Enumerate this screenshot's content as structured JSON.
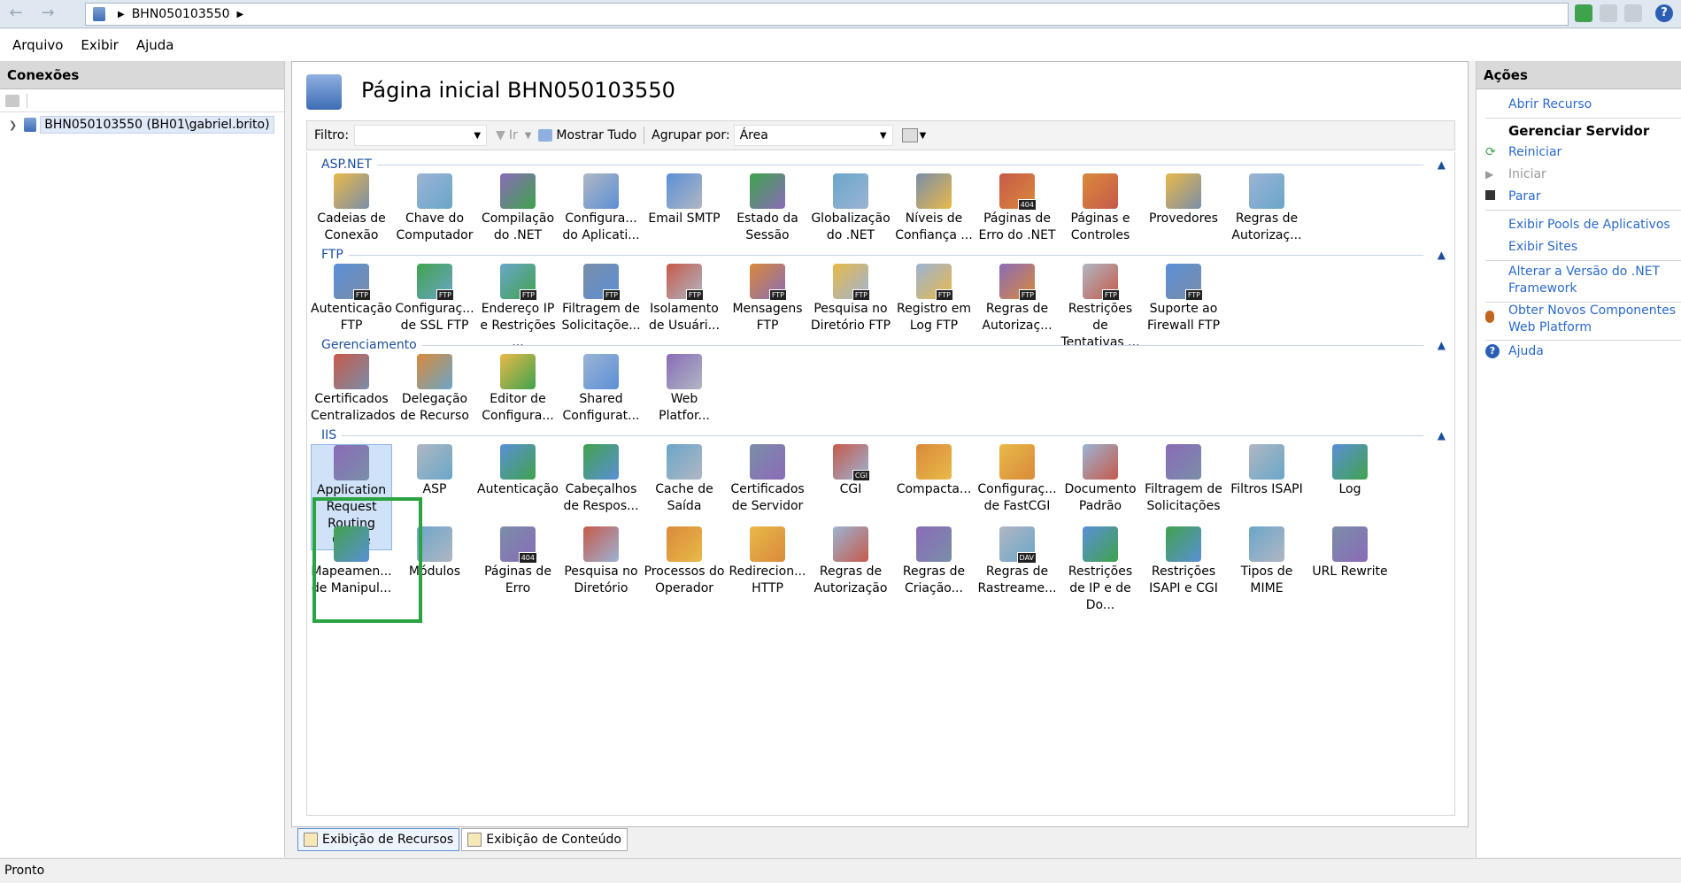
{
  "address": {
    "crumb": "BHN050103550"
  },
  "menu": [
    "Arquivo",
    "Exibir",
    "Ajuda"
  ],
  "connections": {
    "title": "Conexões",
    "node": "BHN050103550 (BH01\\gabriel.brito)"
  },
  "page": {
    "title": "Página inicial BHN050103550"
  },
  "filter": {
    "label": "Filtro:",
    "go": "Ir",
    "show_all": "Mostrar Tudo",
    "group_label": "Agrupar por:",
    "group_value": "Área"
  },
  "sections": {
    "aspnet": {
      "title": "ASP.NET",
      "items": [
        "Cadeias de Conexão",
        "Chave do Computador",
        "Compilação do .NET",
        "Configura... do Aplicati...",
        "Email SMTP",
        "Estado da Sessão",
        "Globalização do .NET",
        "Níveis de Confiança ...",
        "Páginas de Erro do .NET",
        "Páginas e Controles",
        "Provedores",
        "Regras de Autorizaç..."
      ]
    },
    "ftp": {
      "title": "FTP",
      "items": [
        "Autenticação FTP",
        "Configuraç... de SSL FTP",
        "Endereço IP e Restrições ...",
        "Filtragem de Solicitaçõe...",
        "Isolamento de Usuári...",
        "Mensagens FTP",
        "Pesquisa no Diretório FTP",
        "Registro em Log FTP",
        "Regras de Autorizaç...",
        "Restrições de Tentativas ...",
        "Suporte ao Firewall FTP"
      ]
    },
    "mgmt": {
      "title": "Gerenciamento",
      "items": [
        "Certificados Centralizados",
        "Delegação de Recurso",
        "Editor de Configura...",
        "Shared Configurat...",
        "Web Platfor..."
      ]
    },
    "iis": {
      "title": "IIS",
      "items": [
        "Application Request Routing Cache",
        "ASP",
        "Autenticação",
        "Cabeçalhos de Respos...",
        "Cache de Saída",
        "Certificados de Servidor",
        "CGI",
        "Compacta...",
        "Configuraç... de FastCGI",
        "Documento Padrão",
        "Filtragem de Solicitações",
        "Filtros ISAPI",
        "Log",
        "Mapeamen... de Manipul...",
        "Módulos",
        "Páginas de Erro",
        "Pesquisa no Diretório",
        "Processos do Operador",
        "Redirecion... HTTP",
        "Regras de Autorização",
        "Regras de Criação...",
        "Regras de Rastreame...",
        "Restrições de IP e de Do...",
        "Restrições ISAPI e CGI",
        "Tipos de MIME",
        "URL Rewrite"
      ]
    }
  },
  "badges": {
    "ftp": "FTP",
    "err": "404",
    "cgi": "CGI",
    "dav": "DAV"
  },
  "tabs": {
    "features": "Exibição de Recursos",
    "content": "Exibição de Conteúdo"
  },
  "actions": {
    "title": "Ações",
    "open": "Abrir Recurso",
    "manage": "Gerenciar Servidor",
    "restart": "Reiniciar",
    "start": "Iniciar",
    "stop": "Parar",
    "pools": "Exibir Pools de Aplicativos",
    "sites": "Exibir Sites",
    "net": "Alterar a Versão do .NET Framework",
    "webpi": "Obter Novos Componentes Web Platform",
    "help": "Ajuda"
  },
  "status": "Pronto",
  "colors": {
    "accent": "#2a6ac9",
    "section": "#1b4f9c",
    "highlight": "#2aa342"
  }
}
